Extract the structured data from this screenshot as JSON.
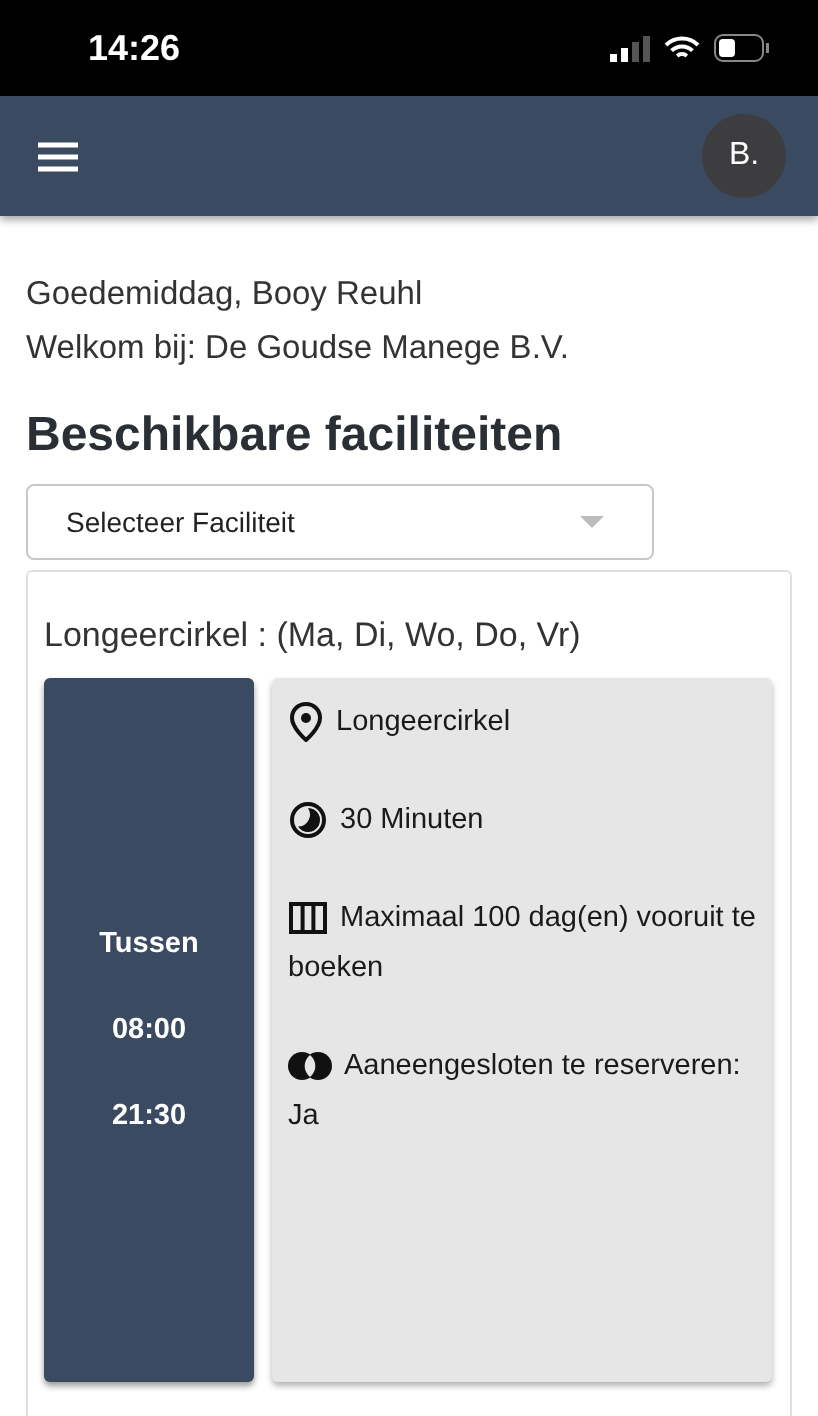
{
  "status_bar": {
    "time": "14:26"
  },
  "header": {
    "avatar": "B."
  },
  "greeting": [
    "Goedemiddag, Booy Reuhl",
    "Welkom bij: De Goudse Manege B.V."
  ],
  "title": "Beschikbare faciliteiten",
  "select": {
    "placeholder": "Selecteer Faciliteit"
  },
  "facility": {
    "title": "Longeercirkel : (Ma, Di, Wo, Do, Vr)",
    "times": [
      "Tussen",
      "08:00",
      "21:30"
    ],
    "details": [
      {
        "kind": "location",
        "text": "Longeercirkel"
      },
      {
        "kind": "duration",
        "text": "30 Minuten"
      },
      {
        "kind": "calendar",
        "text": "Maximaal 100 dag(en) vooruit te boeken"
      },
      {
        "kind": "contiguous",
        "text": "Aaneengesloten te reserveren: Ja"
      }
    ]
  }
}
